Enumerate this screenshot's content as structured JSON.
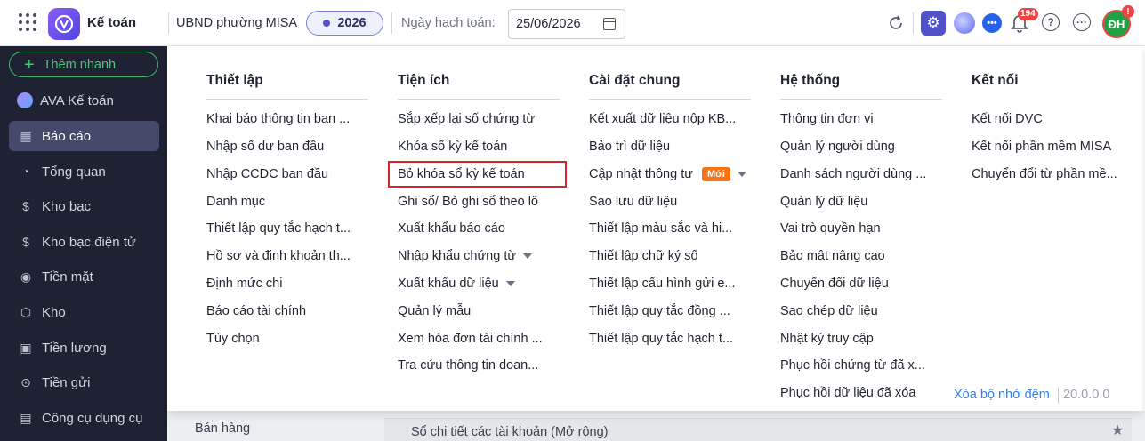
{
  "topbar": {
    "app_title": "Kế toán",
    "org": "UBND phường MISA",
    "year": "2026",
    "date_label": "Ngày hạch toán:",
    "date_value": "25/06/2026",
    "notification_count": "194",
    "user_initials": "ĐH",
    "user_alert": "!"
  },
  "sidebar": {
    "quick_add": "Thêm nhanh",
    "items": [
      {
        "label": "AVA Kế toán",
        "icon": "ava-icon"
      },
      {
        "label": "Báo cáo",
        "icon": "report-icon",
        "active": true
      },
      {
        "label": "Tổng quan",
        "icon": "overview-icon"
      },
      {
        "label": "Kho bạc",
        "icon": "treasury-icon"
      },
      {
        "label": "Kho bạc điện tử",
        "icon": "e-treasury-icon"
      },
      {
        "label": "Tiền mặt",
        "icon": "cash-icon"
      },
      {
        "label": "Kho",
        "icon": "warehouse-icon"
      },
      {
        "label": "Tiền lương",
        "icon": "salary-icon"
      },
      {
        "label": "Tiền gửi",
        "icon": "deposit-icon"
      },
      {
        "label": "Công cụ dụng cụ",
        "icon": "tools-icon"
      }
    ]
  },
  "background": {
    "left_item": "Bán hàng",
    "card_title": "Sổ chi tiết các tài khoản (Mở rộng)"
  },
  "menu": {
    "columns": [
      {
        "title": "Thiết lập",
        "items": [
          "Khai báo thông tin ban ...",
          "Nhập số dư ban đầu",
          "Nhập CCDC ban đầu",
          "Danh mục",
          "Thiết lập quy tắc hạch t...",
          "Hồ sơ và định khoản th...",
          "Định mức chi",
          "Báo cáo tài chính",
          "Tùy chọn"
        ]
      },
      {
        "title": "Tiện ích",
        "items": [
          "Sắp xếp lại số chứng từ",
          "Khóa sổ kỳ kế toán",
          "Bỏ khóa sổ kỳ kế toán",
          "Ghi sổ/ Bỏ ghi sổ theo lô",
          "Xuất khẩu báo cáo",
          "Nhập khẩu chứng từ",
          "Xuất khẩu dữ liệu",
          "Quản lý mẫu",
          "Xem hóa đơn tài chính ...",
          "Tra cứu thông tin doan..."
        ]
      },
      {
        "title": "Cài đặt chung",
        "items": [
          "Kết xuất dữ liệu nộp KB...",
          "Bảo trì dữ liệu",
          "Cập nhật thông tư",
          "Sao lưu dữ liệu",
          "Thiết lập màu sắc và hi...",
          "Thiết lập chữ ký số",
          "Thiết lập cấu hình gửi e...",
          "Thiết lập quy tắc đồng ...",
          "Thiết lập quy tắc hạch t..."
        ],
        "new_badge": "Mới"
      },
      {
        "title": "Hệ thống",
        "items": [
          "Thông tin đơn vị",
          "Quản lý người dùng",
          "Danh sách người dùng ...",
          "Quản lý dữ liệu",
          "Vai trò quyền hạn",
          "Bảo mật nâng cao",
          "Chuyển đổi dữ liệu",
          "Sao chép dữ liệu",
          "Nhật ký truy cập",
          "Phục hồi chứng từ đã x...",
          "Phục hồi dữ liệu đã xóa"
        ]
      },
      {
        "title": "Kết nối",
        "items": [
          "Kết nối DVC",
          "Kết nối phần mềm MISA",
          "Chuyển đổi từ phần mề..."
        ]
      }
    ],
    "footer_link": "Xóa bộ nhớ đệm",
    "version": "20.0.0.0"
  }
}
